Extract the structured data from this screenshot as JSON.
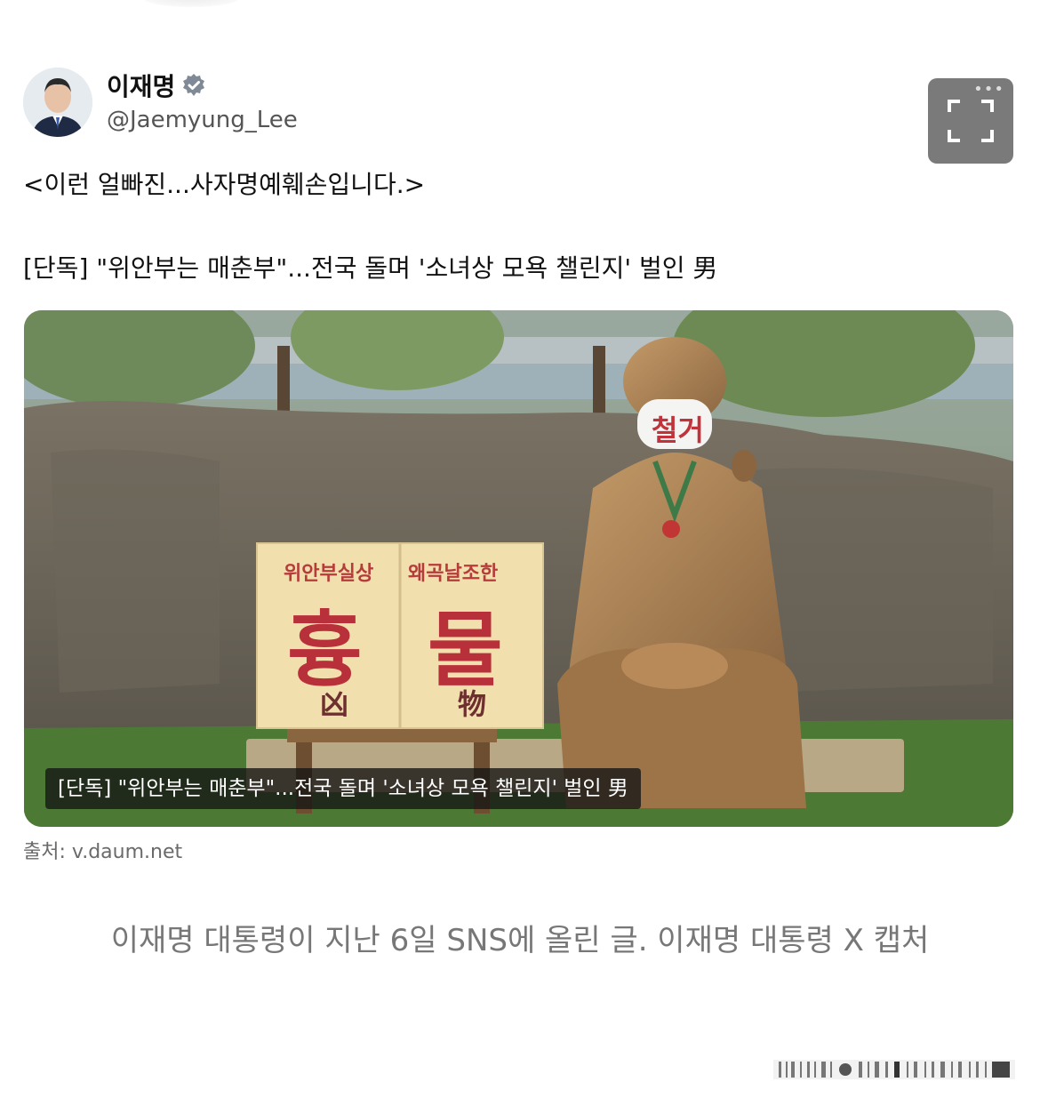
{
  "post": {
    "author_name": "이재명",
    "author_handle": "@Jaemyung_Lee",
    "text_line1": "<이런 얼빠진...사자명예훼손입니다.>",
    "text_line2": "[단독] \"위안부는 매춘부\"...전국 돌며 '소녀상 모욕 챌린지' 벌인 男",
    "expand_dots": "•••"
  },
  "media": {
    "sign_left_small": "위안부실상",
    "sign_right_small": "왜곡날조한",
    "sign_left_big": "흉",
    "sign_right_big": "물",
    "sign_left_hanja": "凶",
    "sign_right_hanja": "物",
    "mask_text": "철거",
    "overlay_caption": "[단독] \"위안부는 매춘부\"...전국 돌며 '소녀상 모욕 챌린지' 벌인 男"
  },
  "source": "출처: v.daum.net",
  "photo_caption": "이재명 대통령이 지난 6일 SNS에 올린 글. 이재명 대통령 X 캡처",
  "colors": {
    "verified": "#7f8a96",
    "expand_bg": "#7a7a7a",
    "sign_red": "#b8303a"
  }
}
